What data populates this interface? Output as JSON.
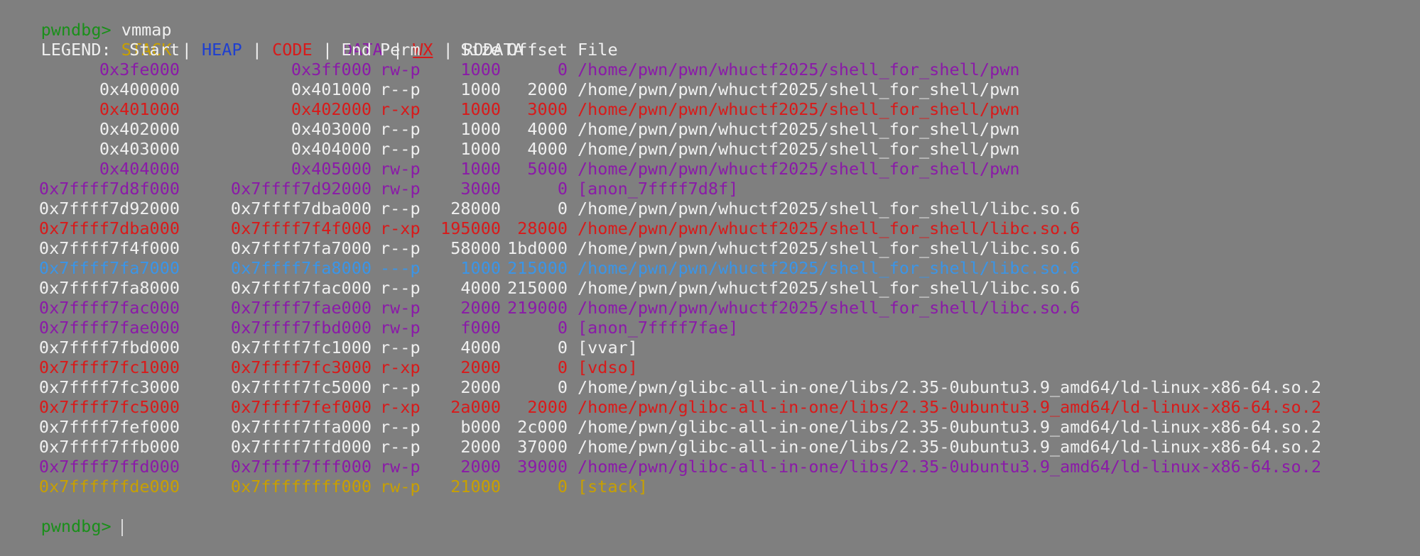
{
  "prompt": {
    "text": "pwndbg>",
    "command": "vmmap"
  },
  "colors": {
    "prompt": "#1a8f1a",
    "stack": "#c8a000",
    "heap": "#1e3fd0",
    "code": "#d81a1a",
    "data": "#8a1aa8",
    "wx": "#d81a1a",
    "rodata": "#f0f0f0",
    "guard": "#3a95e8",
    "separator": "#f0f0f0"
  },
  "legend": {
    "label": "LEGEND:",
    "items": [
      "STACK",
      "HEAP",
      "CODE",
      "DATA",
      "WX",
      "RODATA"
    ],
    "separator": "|"
  },
  "headers": {
    "start": "Start",
    "end": "End",
    "perm": "Perm",
    "size": "Size",
    "offset": "Offset",
    "file": "File"
  },
  "rows": [
    {
      "start": "0x3fe000",
      "end": "0x3ff000",
      "perm": "rw-p",
      "size": "1000",
      "offset": "0",
      "file": "/home/pwn/pwn/whuctf2025/shell_for_shell/pwn",
      "kind": "data"
    },
    {
      "start": "0x400000",
      "end": "0x401000",
      "perm": "r--p",
      "size": "1000",
      "offset": "2000",
      "file": "/home/pwn/pwn/whuctf2025/shell_for_shell/pwn",
      "kind": "rodata"
    },
    {
      "start": "0x401000",
      "end": "0x402000",
      "perm": "r-xp",
      "size": "1000",
      "offset": "3000",
      "file": "/home/pwn/pwn/whuctf2025/shell_for_shell/pwn",
      "kind": "code"
    },
    {
      "start": "0x402000",
      "end": "0x403000",
      "perm": "r--p",
      "size": "1000",
      "offset": "4000",
      "file": "/home/pwn/pwn/whuctf2025/shell_for_shell/pwn",
      "kind": "rodata"
    },
    {
      "start": "0x403000",
      "end": "0x404000",
      "perm": "r--p",
      "size": "1000",
      "offset": "4000",
      "file": "/home/pwn/pwn/whuctf2025/shell_for_shell/pwn",
      "kind": "rodata"
    },
    {
      "start": "0x404000",
      "end": "0x405000",
      "perm": "rw-p",
      "size": "1000",
      "offset": "5000",
      "file": "/home/pwn/pwn/whuctf2025/shell_for_shell/pwn",
      "kind": "data"
    },
    {
      "start": "0x7ffff7d8f000",
      "end": "0x7ffff7d92000",
      "perm": "rw-p",
      "size": "3000",
      "offset": "0",
      "file": "[anon_7ffff7d8f]",
      "kind": "data"
    },
    {
      "start": "0x7ffff7d92000",
      "end": "0x7ffff7dba000",
      "perm": "r--p",
      "size": "28000",
      "offset": "0",
      "file": "/home/pwn/pwn/whuctf2025/shell_for_shell/libc.so.6",
      "kind": "rodata"
    },
    {
      "start": "0x7ffff7dba000",
      "end": "0x7ffff7f4f000",
      "perm": "r-xp",
      "size": "195000",
      "offset": "28000",
      "file": "/home/pwn/pwn/whuctf2025/shell_for_shell/libc.so.6",
      "kind": "code"
    },
    {
      "start": "0x7ffff7f4f000",
      "end": "0x7ffff7fa7000",
      "perm": "r--p",
      "size": "58000",
      "offset": "1bd000",
      "file": "/home/pwn/pwn/whuctf2025/shell_for_shell/libc.so.6",
      "kind": "rodata"
    },
    {
      "start": "0x7ffff7fa7000",
      "end": "0x7ffff7fa8000",
      "perm": "---p",
      "size": "1000",
      "offset": "215000",
      "file": "/home/pwn/pwn/whuctf2025/shell_for_shell/libc.so.6",
      "kind": "guard"
    },
    {
      "start": "0x7ffff7fa8000",
      "end": "0x7ffff7fac000",
      "perm": "r--p",
      "size": "4000",
      "offset": "215000",
      "file": "/home/pwn/pwn/whuctf2025/shell_for_shell/libc.so.6",
      "kind": "rodata"
    },
    {
      "start": "0x7ffff7fac000",
      "end": "0x7ffff7fae000",
      "perm": "rw-p",
      "size": "2000",
      "offset": "219000",
      "file": "/home/pwn/pwn/whuctf2025/shell_for_shell/libc.so.6",
      "kind": "data"
    },
    {
      "start": "0x7ffff7fae000",
      "end": "0x7ffff7fbd000",
      "perm": "rw-p",
      "size": "f000",
      "offset": "0",
      "file": "[anon_7ffff7fae]",
      "kind": "data"
    },
    {
      "start": "0x7ffff7fbd000",
      "end": "0x7ffff7fc1000",
      "perm": "r--p",
      "size": "4000",
      "offset": "0",
      "file": "[vvar]",
      "kind": "rodata"
    },
    {
      "start": "0x7ffff7fc1000",
      "end": "0x7ffff7fc3000",
      "perm": "r-xp",
      "size": "2000",
      "offset": "0",
      "file": "[vdso]",
      "kind": "code"
    },
    {
      "start": "0x7ffff7fc3000",
      "end": "0x7ffff7fc5000",
      "perm": "r--p",
      "size": "2000",
      "offset": "0",
      "file": "/home/pwn/glibc-all-in-one/libs/2.35-0ubuntu3.9_amd64/ld-linux-x86-64.so.2",
      "kind": "rodata"
    },
    {
      "start": "0x7ffff7fc5000",
      "end": "0x7ffff7fef000",
      "perm": "r-xp",
      "size": "2a000",
      "offset": "2000",
      "file": "/home/pwn/glibc-all-in-one/libs/2.35-0ubuntu3.9_amd64/ld-linux-x86-64.so.2",
      "kind": "code"
    },
    {
      "start": "0x7ffff7fef000",
      "end": "0x7ffff7ffa000",
      "perm": "r--p",
      "size": "b000",
      "offset": "2c000",
      "file": "/home/pwn/glibc-all-in-one/libs/2.35-0ubuntu3.9_amd64/ld-linux-x86-64.so.2",
      "kind": "rodata"
    },
    {
      "start": "0x7ffff7ffb000",
      "end": "0x7ffff7ffd000",
      "perm": "r--p",
      "size": "2000",
      "offset": "37000",
      "file": "/home/pwn/glibc-all-in-one/libs/2.35-0ubuntu3.9_amd64/ld-linux-x86-64.so.2",
      "kind": "rodata"
    },
    {
      "start": "0x7ffff7ffd000",
      "end": "0x7ffff7fff000",
      "perm": "rw-p",
      "size": "2000",
      "offset": "39000",
      "file": "/home/pwn/glibc-all-in-one/libs/2.35-0ubuntu3.9_amd64/ld-linux-x86-64.so.2",
      "kind": "data"
    },
    {
      "start": "0x7ffffffde000",
      "end": "0x7ffffffff000",
      "perm": "rw-p",
      "size": "21000",
      "offset": "0",
      "file": "[stack]",
      "kind": "stack"
    }
  ],
  "bottom_prompt": {
    "text": "pwndbg>"
  }
}
